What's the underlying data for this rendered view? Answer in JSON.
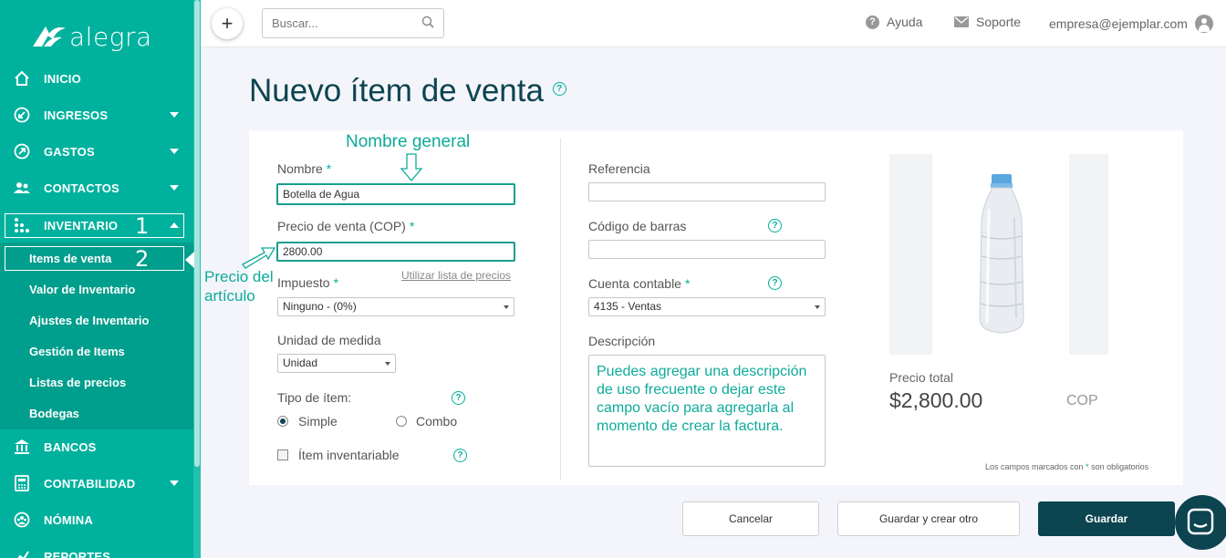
{
  "brand": {
    "name": "alegra"
  },
  "sidebar": {
    "items": [
      {
        "label": "INICIO",
        "icon": "home-icon"
      },
      {
        "label": "INGRESOS",
        "icon": "income-icon",
        "expandable": true
      },
      {
        "label": "GASTOS",
        "icon": "expenses-icon",
        "expandable": true
      },
      {
        "label": "CONTACTOS",
        "icon": "contacts-icon",
        "expandable": true
      },
      {
        "label": "INVENTARIO",
        "icon": "inventory-icon",
        "expandable": true,
        "expanded": true
      },
      {
        "label": "BANCOS",
        "icon": "bank-icon"
      },
      {
        "label": "CONTABILIDAD",
        "icon": "accounting-icon",
        "expandable": true
      },
      {
        "label": "NÓMINA",
        "icon": "payroll-icon"
      },
      {
        "label": "REPORTES",
        "icon": "reports-icon"
      }
    ],
    "subitems": [
      "Items de venta",
      "Valor de Inventario",
      "Ajustes de Inventario",
      "Gestión de Items",
      "Listas de precios",
      "Bodegas"
    ],
    "step_labels": [
      "1",
      "2"
    ]
  },
  "topbar": {
    "add_label": "+",
    "search_placeholder": "Buscar...",
    "help_label": "Ayuda",
    "support_label": "Soporte",
    "user_email": "empresa@ejemplar.com"
  },
  "page": {
    "title": "Nuevo ítem de venta"
  },
  "form": {
    "name_label": "Nombre",
    "name_value": "Botella de Agua",
    "price_label": "Precio de venta (COP)",
    "price_value": "2800.00",
    "price_list_link": "Utilizar lista de precios",
    "tax_label": "Impuesto",
    "tax_value": "Ninguno - (0%)",
    "unit_label": "Unidad de medida",
    "unit_value": "Unidad",
    "item_type_label": "Tipo de ítem:",
    "type_simple": "Simple",
    "type_combo": "Combo",
    "selected_type": "Simple",
    "inventory_label": "Ítem inventariable",
    "inventory_checked": false,
    "reference_label": "Referencia",
    "reference_value": "",
    "barcode_label": "Código de barras",
    "barcode_value": "",
    "account_label": "Cuenta contable",
    "account_value": "4135 - Ventas",
    "description_label": "Descripción",
    "description_value": "Puedes agregar una descripción de uso frecuente o dejar este campo vacío para agregarla al momento de crear la factura.",
    "required_marker": "*"
  },
  "annotations": {
    "name": "Nombre general",
    "price_line1": "Precio del",
    "price_line2": "artículo"
  },
  "summary": {
    "total_label": "Precio total",
    "total_value": "$2,800.00",
    "currency": "COP",
    "footnote_pre": "Los campos marcados con",
    "footnote_mark": "*",
    "footnote_post": "son obligatorios"
  },
  "actions": {
    "cancel": "Cancelar",
    "save_and_new": "Guardar y crear otro",
    "save": "Guardar"
  },
  "colors": {
    "sidebar": "#00b19d",
    "submenu": "#009e8c",
    "primary": "#0c4450",
    "accent": "#00b19d"
  }
}
